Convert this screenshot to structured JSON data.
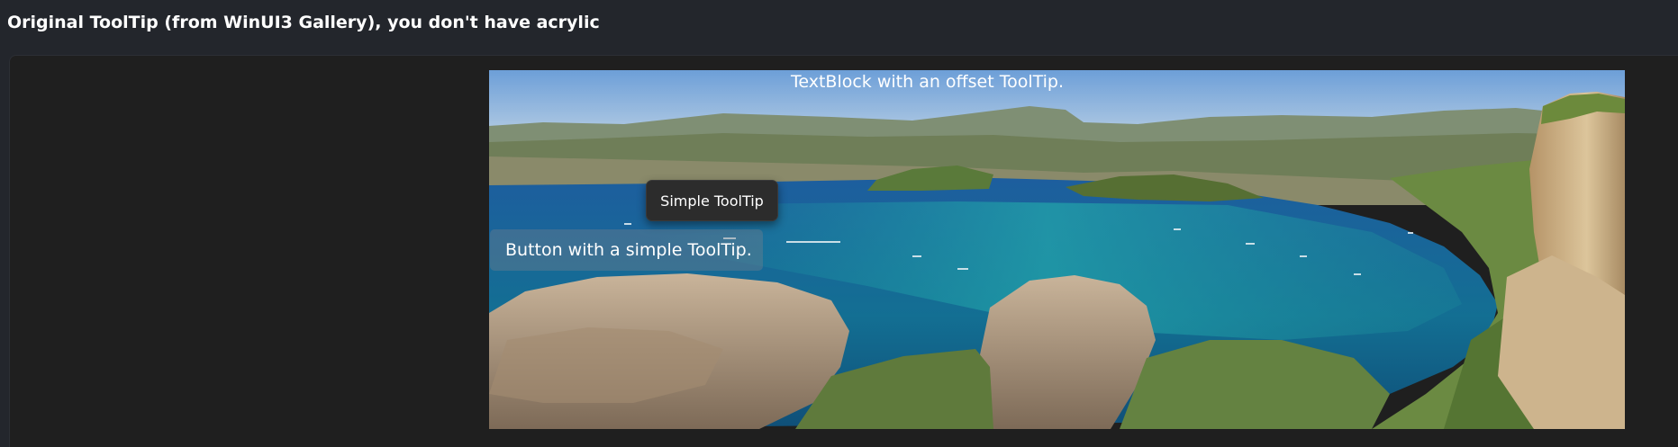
{
  "page": {
    "title": "Original ToolTip (from WinUI3 Gallery), you don't have acrylic"
  },
  "sample": {
    "offset_textblock_label": "TextBlock with an offset ToolTip.",
    "simple_tooltip_text": "Simple ToolTip",
    "button_label": "Button with a simple ToolTip."
  },
  "colors": {
    "background": "#23262c",
    "card_background": "#1f1f1f",
    "tooltip_background": "#2c2c2c",
    "text": "#ffffff"
  }
}
